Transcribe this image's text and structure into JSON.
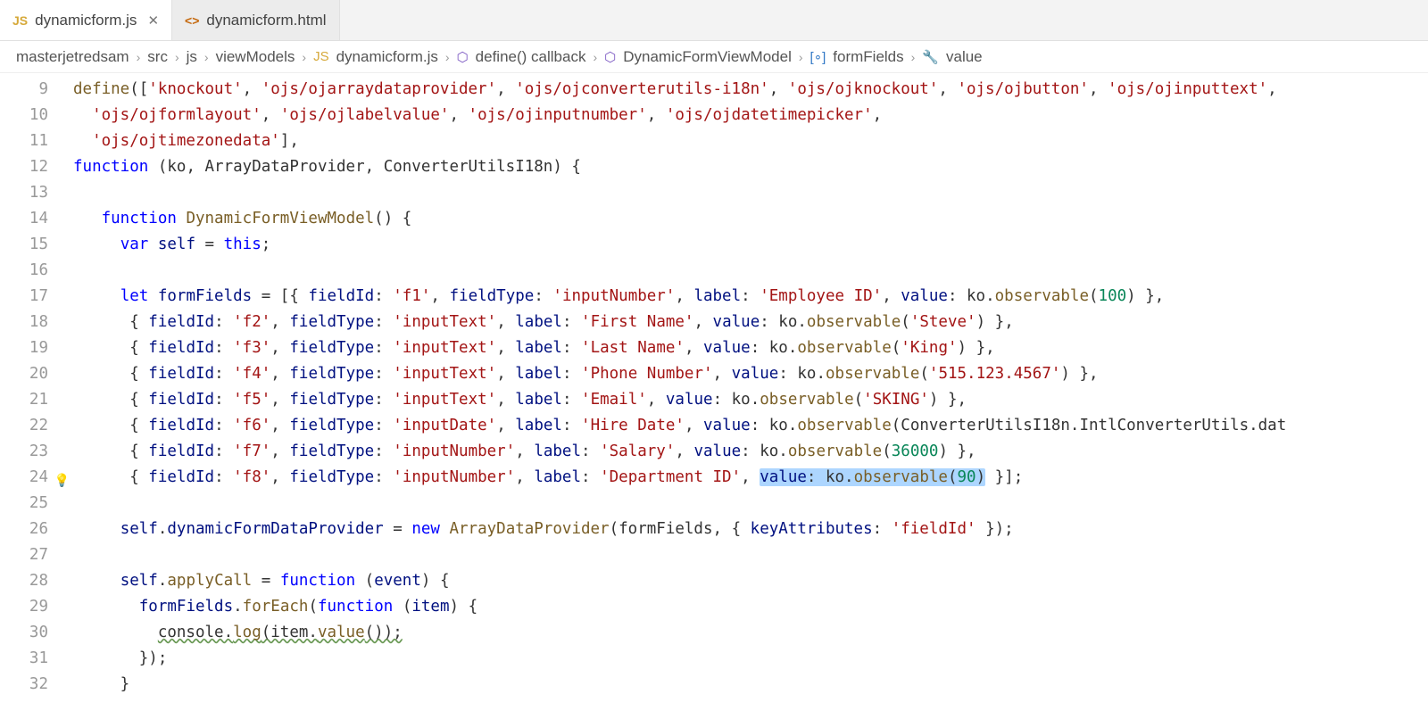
{
  "tabs": [
    {
      "icon": "JS",
      "label": "dynamicform.js",
      "active": true,
      "closeable": true
    },
    {
      "icon": "<>",
      "label": "dynamicform.html",
      "active": false,
      "closeable": false
    }
  ],
  "breadcrumb": {
    "items": [
      {
        "label": "masterjetredsam",
        "icon": ""
      },
      {
        "label": "src",
        "icon": ""
      },
      {
        "label": "js",
        "icon": ""
      },
      {
        "label": "viewModels",
        "icon": ""
      },
      {
        "label": "dynamicform.js",
        "icon": "JS"
      },
      {
        "label": "define() callback",
        "icon": "cube"
      },
      {
        "label": "DynamicFormViewModel",
        "icon": "cube"
      },
      {
        "label": "formFields",
        "icon": "brackets"
      },
      {
        "label": "value",
        "icon": "wrench"
      }
    ]
  },
  "lineStart": 9,
  "lineEnd": 32,
  "bulbLine": 24,
  "code": {
    "modules": [
      "knockout",
      "ojs/ojarraydataprovider",
      "ojs/ojconverterutils-i18n",
      "ojs/ojknockout",
      "ojs/ojbutton",
      "ojs/ojinputtext",
      "ojs/ojformlayout",
      "ojs/ojlabelvalue",
      "ojs/ojinputnumber",
      "ojs/ojdatetimepicker",
      "ojs/ojtimezonedata"
    ],
    "fnParams": "ko, ArrayDataProvider, ConverterUtilsI18n",
    "viewModelName": "DynamicFormViewModel",
    "formFields": [
      {
        "fieldId": "f1",
        "fieldType": "inputNumber",
        "label": "Employee ID",
        "valueExpr": "ko.observable(100)",
        "valueNum": "100"
      },
      {
        "fieldId": "f2",
        "fieldType": "inputText",
        "label": "First Name",
        "valueExpr": "ko.observable('Steve')",
        "valueStr": "Steve"
      },
      {
        "fieldId": "f3",
        "fieldType": "inputText",
        "label": "Last Name",
        "valueExpr": "ko.observable('King')",
        "valueStr": "King"
      },
      {
        "fieldId": "f4",
        "fieldType": "inputText",
        "label": "Phone Number",
        "valueExpr": "ko.observable('515.123.4567')",
        "valueStr": "515.123.4567"
      },
      {
        "fieldId": "f5",
        "fieldType": "inputText",
        "label": "Email",
        "valueExpr": "ko.observable('SKING')",
        "valueStr": "SKING"
      },
      {
        "fieldId": "f6",
        "fieldType": "inputDate",
        "label": "Hire Date",
        "valueExpr": "ko.observable(ConverterUtilsI18n.IntlConverterUtils.dat"
      },
      {
        "fieldId": "f7",
        "fieldType": "inputNumber",
        "label": "Salary",
        "valueExpr": "ko.observable(36000)",
        "valueNum": "36000"
      },
      {
        "fieldId": "f8",
        "fieldType": "inputNumber",
        "label": "Department ID",
        "valueExpr": "ko.observable(90)",
        "valueNum": "90"
      }
    ],
    "keyAttributes": "fieldId",
    "applyCall": "applyCall",
    "consoleLog": "console.log(item.value());"
  }
}
